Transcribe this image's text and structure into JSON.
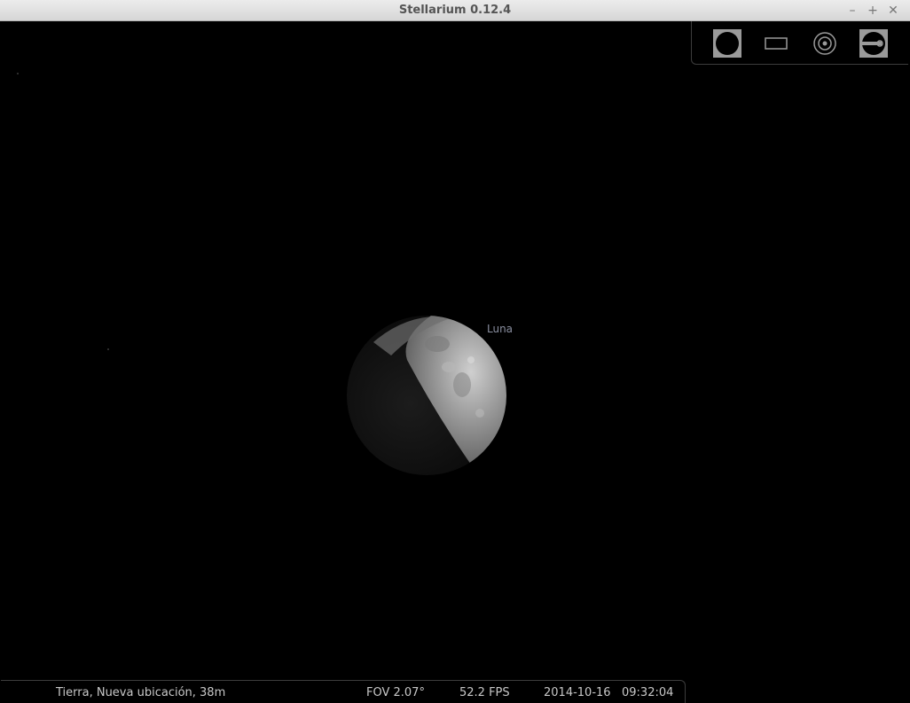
{
  "window": {
    "title": "Stellarium 0.12.4",
    "controls": {
      "minimize": "–",
      "maximize": "+",
      "close": "✕"
    }
  },
  "toolbar": {
    "buttons": [
      {
        "icon": "full-moon-icon"
      },
      {
        "icon": "ocular-rectangle-icon"
      },
      {
        "icon": "telescope-target-icon"
      },
      {
        "icon": "ccd-sensor-icon"
      }
    ]
  },
  "sky": {
    "object_label": "Luna"
  },
  "status": {
    "location": "Tierra, Nueva ubicación, 38m",
    "fov": "FOV 2.07°",
    "fps": "52.2 FPS",
    "date": "2014-10-16",
    "time": "09:32:04"
  }
}
